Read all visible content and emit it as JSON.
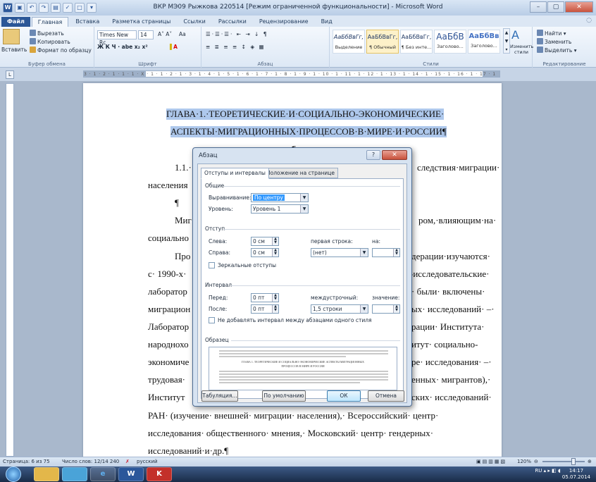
{
  "window": {
    "title": "ВКР МЭ09 Рыжкова 220514 [Режим ограниченной функциональности] - Microsoft Word",
    "controls": [
      "–",
      "▢",
      "✕"
    ]
  },
  "ribbon_tabs": [
    "Файл",
    "Главная",
    "Вставка",
    "Разметка страницы",
    "Ссылки",
    "Рассылки",
    "Рецензирование",
    "Вид"
  ],
  "ribbon": {
    "clipboard": {
      "paste": "Вставить",
      "cut": "Вырезать",
      "copy": "Копировать",
      "format_painter": "Формат по образцу",
      "label": "Буфер обмена"
    },
    "font": {
      "name": "Times New Rc",
      "size": "14",
      "aa": "Aa",
      "bold_row": "Ж  К  Ч  ·  abe  x₂  x²",
      "label": "Шрифт"
    },
    "paragraph": {
      "label": "Абзац"
    },
    "styles": {
      "items": [
        {
          "sample": "АаБбВвГг,",
          "name": "Выделение"
        },
        {
          "sample": "АаБбВвГг,",
          "name": "¶ Обычный"
        },
        {
          "sample": "АаБбВвГг,",
          "name": "¶ Без инте..."
        },
        {
          "sample": "АаБбВ",
          "name": "Заголово..."
        },
        {
          "sample": "АаБбВв",
          "name": "Заголово..."
        }
      ],
      "change_styles": "Изменить стили",
      "label": "Стили"
    },
    "editing": {
      "find": "Найти",
      "replace": "Заменить",
      "select": "Выделить",
      "label": "Редактирование"
    }
  },
  "ruler_text": "3 · 1 · 2 · 1 · 1 · 1 · X · 1 · 1 · 2 · 1 · 3 · 1 · 4 · 1 · 5 · 1 · 6 · 1 · 7 · 1 · 8 · 1 · 9 · 1 · 10 · 1 · 11 · 1 · 12 · 1 · 13 · 1 · 14 · 1 · 15 · 1 · 16 · 1 · 17 · 1",
  "document": {
    "heading1": "ГЛАВА·1.·ТЕОРЕТИЧЕСКИЕ·И·СОЦИАЛЬНО-ЭКОНОМИЧЕСКИЕ·",
    "heading2": "АСПЕКТЫ·МИГРАЦИОННЫХ·ПРОЦЕССОВ·В·МИРЕ·И·РОССИИ¶",
    "pilcrow": "¶",
    "left": [
      "1.1.·",
      "населения",
      "¶",
      "Миг",
      "социально",
      "Про",
      "с· 1990-х·",
      "лаборатор",
      "миграцион",
      "Лаборатор",
      "народнохо",
      "экономиче",
      "трудовая·",
      "Институт"
    ],
    "right": [
      "следствия·миграции·",
      "ром,·влияющим·на·",
      "дерации·изучаются·",
      "-исследовательские·",
      "·   были·   включены·",
      "ых·  исследований·  –·",
      "рации·   Института·",
      "итут·   социально-",
      "ре·  исследования·  –·",
      "енных·  мигрантов),·",
      "ских·  исследований·"
    ],
    "full1": "РАН·  (изучение·  внешней·  миграции·  населения),·  Всероссийский·  центр·",
    "full2": "исследования·  общественного·  мнения,·  Московский·  центр·  гендерных·",
    "full3": "исследований·и·др.¶"
  },
  "dialog": {
    "title": "Абзац",
    "help": "?",
    "close": "✕",
    "tabs": [
      "Отступы и интервалы",
      "Положение на странице"
    ],
    "general": {
      "label": "Общие",
      "alignment_label": "Выравнивание:",
      "alignment_value": "По центру",
      "level_label": "Уровень:",
      "level_value": "Уровень 1"
    },
    "indent": {
      "label": "Отступ",
      "left_label": "Слева:",
      "left_value": "0 см",
      "right_label": "Справа:",
      "right_value": "0 см",
      "first_line_label": "первая строка:",
      "first_line_value": "(нет)",
      "by_label": "на:",
      "mirror_label": "Зеркальные отступы"
    },
    "spacing": {
      "label": "Интервал",
      "before_label": "Перед:",
      "before_value": "0 пт",
      "after_label": "После:",
      "after_value": "0 пт",
      "line_label": "междустрочный:",
      "line_value": "1,5 строки",
      "value_label": "значение:",
      "no_space_label": "Не добавлять интервал между абзацами одного стиля"
    },
    "preview": {
      "label": "Образец",
      "text1": "ГЛАВА 1. ТЕОРЕТИЧЕСКИЕ И СОЦИАЛЬНО-ЭКОНОМИЧЕСКИЕ АСПЕКТЫ МИГРАЦИОННЫХ",
      "text2": "ПРОЦЕССОВ В МИРЕ И РОССИИ"
    },
    "buttons": {
      "tabs": "Табуляция...",
      "default": "По умолчанию",
      "ok": "ОК",
      "cancel": "Отмена"
    }
  },
  "statusbar": {
    "page": "Страница: 6 из 75",
    "words": "Число слов: 12/14 240",
    "lang": "русский",
    "zoom": "120%"
  },
  "taskbar": {
    "apps": [
      "",
      "",
      "",
      "e",
      "W",
      "K"
    ],
    "lang": "RU",
    "time": "14:17",
    "date": "05.07.2014"
  }
}
